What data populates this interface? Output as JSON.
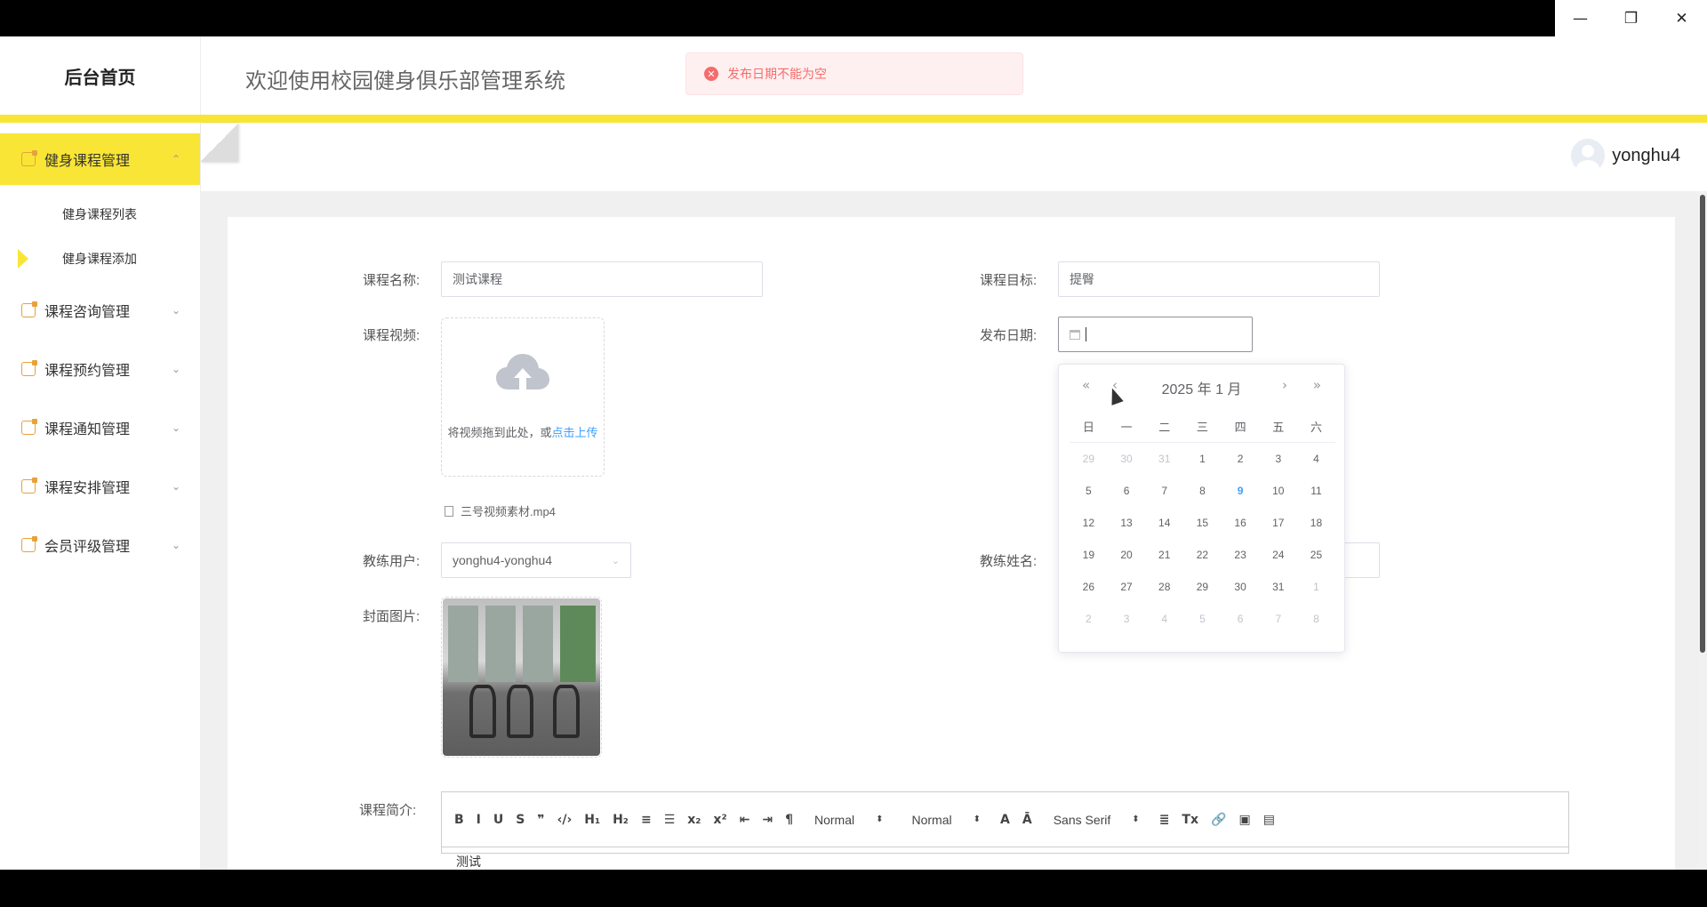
{
  "window": {
    "minimize": "—",
    "restore": "❐",
    "close": "✕"
  },
  "header": {
    "logo": "后台首页",
    "system_title": "欢迎使用校园健身俱乐部管理系统"
  },
  "alert": {
    "icon": "✕",
    "message": "发布日期不能为空"
  },
  "user": {
    "name": "yonghu4"
  },
  "sidebar": {
    "items": [
      {
        "label": "健身课程管理",
        "arrow": "⌃",
        "expanded": true,
        "children": [
          {
            "label": "健身课程列表"
          },
          {
            "label": "健身课程添加"
          }
        ]
      },
      {
        "label": "课程咨询管理",
        "arrow": "⌄"
      },
      {
        "label": "课程预约管理",
        "arrow": "⌄"
      },
      {
        "label": "课程通知管理",
        "arrow": "⌄"
      },
      {
        "label": "课程安排管理",
        "arrow": "⌄"
      },
      {
        "label": "会员评级管理",
        "arrow": "⌄"
      }
    ]
  },
  "form": {
    "course_name": {
      "label": "课程名称:",
      "value": "测试课程"
    },
    "course_goal": {
      "label": "课程目标:",
      "value": "提臀"
    },
    "course_video": {
      "label": "课程视频:",
      "upload_text": "将视频拖到此处，或",
      "upload_link": "点击上传",
      "file_name": "三号视频素材.mp4"
    },
    "publish_date": {
      "label": "发布日期:",
      "value": ""
    },
    "coach_user": {
      "label": "教练用户:",
      "value": "yonghu4-yonghu4"
    },
    "coach_name": {
      "label": "教练姓名:"
    },
    "cover_image": {
      "label": "封面图片:"
    },
    "course_intro": {
      "label": "课程简介:",
      "content": "测试"
    }
  },
  "datepicker": {
    "year_month": "2025 年  1 月",
    "nav": {
      "prev_year": "«",
      "prev_month": "‹",
      "next_month": "›",
      "next_year": "»"
    },
    "weekdays": [
      "日",
      "一",
      "二",
      "三",
      "四",
      "五",
      "六"
    ],
    "weeks": [
      [
        {
          "d": "29",
          "off": true
        },
        {
          "d": "30",
          "off": true
        },
        {
          "d": "31",
          "off": true
        },
        {
          "d": "1"
        },
        {
          "d": "2"
        },
        {
          "d": "3"
        },
        {
          "d": "4"
        }
      ],
      [
        {
          "d": "5"
        },
        {
          "d": "6"
        },
        {
          "d": "7"
        },
        {
          "d": "8"
        },
        {
          "d": "9",
          "today": true
        },
        {
          "d": "10"
        },
        {
          "d": "11"
        }
      ],
      [
        {
          "d": "12"
        },
        {
          "d": "13"
        },
        {
          "d": "14"
        },
        {
          "d": "15"
        },
        {
          "d": "16"
        },
        {
          "d": "17"
        },
        {
          "d": "18"
        }
      ],
      [
        {
          "d": "19"
        },
        {
          "d": "20"
        },
        {
          "d": "21"
        },
        {
          "d": "22"
        },
        {
          "d": "23"
        },
        {
          "d": "24"
        },
        {
          "d": "25"
        }
      ],
      [
        {
          "d": "26"
        },
        {
          "d": "27"
        },
        {
          "d": "28"
        },
        {
          "d": "29"
        },
        {
          "d": "30"
        },
        {
          "d": "31"
        },
        {
          "d": "1",
          "off": true
        }
      ],
      [
        {
          "d": "2",
          "off": true
        },
        {
          "d": "3",
          "off": true
        },
        {
          "d": "4",
          "off": true
        },
        {
          "d": "5",
          "off": true
        },
        {
          "d": "6",
          "off": true
        },
        {
          "d": "7",
          "off": true
        },
        {
          "d": "8",
          "off": true
        }
      ]
    ]
  },
  "editor_toolbar": {
    "buttons": [
      {
        "name": "bold",
        "glyph": "B"
      },
      {
        "name": "italic",
        "glyph": "I"
      },
      {
        "name": "underline",
        "glyph": "U"
      },
      {
        "name": "strike",
        "glyph": "S"
      },
      {
        "name": "blockquote",
        "glyph": "❞"
      },
      {
        "name": "code",
        "glyph": "‹/›"
      },
      {
        "name": "h1",
        "glyph": "H₁"
      },
      {
        "name": "h2",
        "glyph": "H₂"
      },
      {
        "name": "ordered-list",
        "glyph": "≡"
      },
      {
        "name": "bullet-list",
        "glyph": "☰"
      },
      {
        "name": "subscript",
        "glyph": "x₂"
      },
      {
        "name": "superscript",
        "glyph": "x²"
      },
      {
        "name": "outdent",
        "glyph": "⇤"
      },
      {
        "name": "indent",
        "glyph": "⇥"
      },
      {
        "name": "direction",
        "glyph": "¶"
      }
    ],
    "size_select": "Normal",
    "header_select": "Normal",
    "color_glyph": "A",
    "bg_glyph": "Ā",
    "font_select": "Sans Serif",
    "tail_buttons": [
      {
        "name": "align",
        "glyph": "≣"
      },
      {
        "name": "clean",
        "glyph": "Tx"
      },
      {
        "name": "link",
        "glyph": "🔗"
      },
      {
        "name": "image",
        "glyph": "▣"
      },
      {
        "name": "video",
        "glyph": "▤"
      }
    ]
  }
}
